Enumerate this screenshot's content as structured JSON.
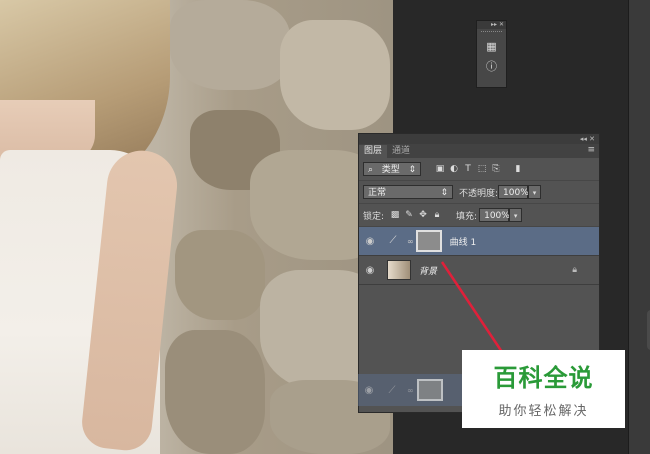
{
  "layers_panel": {
    "tabs": [
      {
        "label": "图层"
      },
      {
        "label": "通道"
      }
    ],
    "filter": {
      "label": "类型"
    },
    "blend_mode": "正常",
    "opacity_label": "不透明度:",
    "opacity_value": "100%",
    "lock_label": "锁定:",
    "fill_label": "填充:",
    "fill_value": "100%",
    "layers": [
      {
        "name": "曲线 1",
        "selected": true
      },
      {
        "name": "背景",
        "selected": false
      }
    ]
  },
  "watermark": {
    "title": "百科全说",
    "subtitle": "助你轻松解决",
    "title_color": "#2a9a38"
  },
  "colors": {
    "selected_layer": "#5b6c86",
    "arrow": "#e0203a",
    "panel": "#535353"
  }
}
